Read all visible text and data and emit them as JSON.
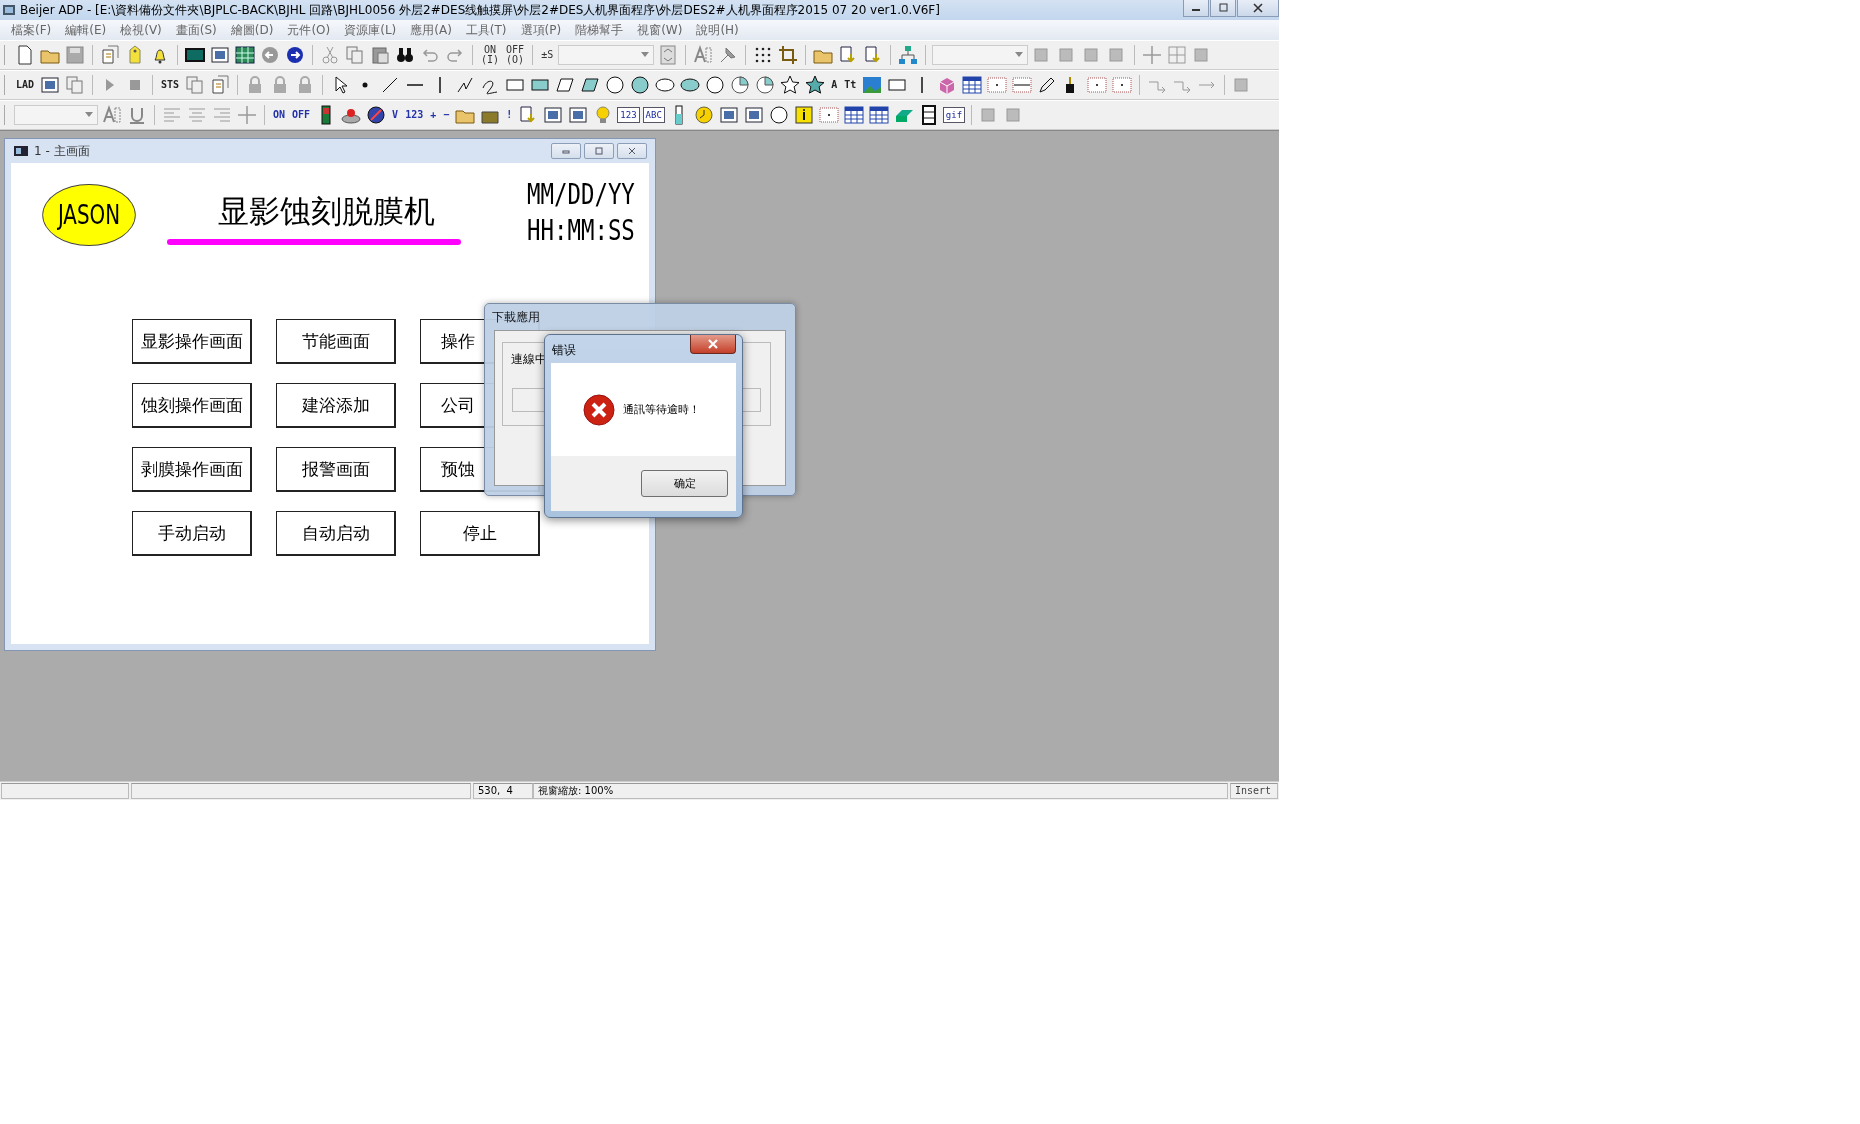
{
  "window": {
    "title": "Beijer ADP - [E:\\資料備份文件夾\\BJPLC-BACK\\BJHL 回路\\BJHL0056 外层2#DES线触摸屏\\外层2#DES人机界面程序\\外层DES2#人机界面程序2015 07 20 ver1.0.V6F]"
  },
  "menu": [
    "檔案(F)",
    "編輯(E)",
    "檢視(V)",
    "畫面(S)",
    "繪圖(D)",
    "元件(O)",
    "資源庫(L)",
    "應用(A)",
    "工具(T)",
    "選項(P)",
    "階梯幫手",
    "視窗(W)",
    "說明(H)"
  ],
  "toolbars": [
    {
      "items": [
        {
          "kind": "icon"
        },
        {
          "kind": "icon"
        },
        {
          "kind": "icon"
        },
        {
          "kind": "sep"
        },
        {
          "kind": "icon"
        },
        {
          "kind": "icon"
        },
        {
          "kind": "icon"
        },
        {
          "kind": "sep"
        },
        {
          "kind": "icon"
        },
        {
          "kind": "icon"
        },
        {
          "kind": "icon"
        },
        {
          "kind": "icon"
        },
        {
          "kind": "icon"
        },
        {
          "kind": "sep"
        },
        {
          "kind": "icon"
        },
        {
          "kind": "icon"
        },
        {
          "kind": "icon"
        },
        {
          "kind": "icon"
        },
        {
          "kind": "icon"
        },
        {
          "kind": "icon"
        },
        {
          "kind": "sep"
        },
        {
          "kind": "text",
          "label": "ON",
          "sub": "(I)"
        },
        {
          "kind": "text",
          "label": "OFF",
          "sub": "(O)"
        },
        {
          "kind": "sep"
        },
        {
          "kind": "text",
          "label": "±S"
        },
        {
          "kind": "combo"
        },
        {
          "kind": "icon"
        },
        {
          "kind": "sep"
        },
        {
          "kind": "icon"
        },
        {
          "kind": "icon"
        },
        {
          "kind": "sep"
        },
        {
          "kind": "icon"
        },
        {
          "kind": "icon"
        },
        {
          "kind": "sep"
        },
        {
          "kind": "icon"
        },
        {
          "kind": "icon"
        },
        {
          "kind": "icon"
        },
        {
          "kind": "sep"
        },
        {
          "kind": "icon"
        },
        {
          "kind": "sep"
        },
        {
          "kind": "combo"
        },
        {
          "kind": "icon"
        },
        {
          "kind": "icon"
        },
        {
          "kind": "icon"
        },
        {
          "kind": "icon"
        },
        {
          "kind": "sep"
        },
        {
          "kind": "icon"
        },
        {
          "kind": "icon"
        },
        {
          "kind": "icon"
        }
      ]
    },
    {
      "items": [
        {
          "kind": "text",
          "label": "LAD"
        },
        {
          "kind": "icon"
        },
        {
          "kind": "icon"
        },
        {
          "kind": "sep"
        },
        {
          "kind": "icon"
        },
        {
          "kind": "icon"
        },
        {
          "kind": "sep"
        },
        {
          "kind": "text",
          "label": "STS"
        },
        {
          "kind": "icon"
        },
        {
          "kind": "icon"
        },
        {
          "kind": "sep"
        },
        {
          "kind": "icon"
        },
        {
          "kind": "icon"
        },
        {
          "kind": "icon"
        },
        {
          "kind": "sep"
        },
        {
          "kind": "icon"
        },
        {
          "kind": "icon"
        },
        {
          "kind": "icon"
        },
        {
          "kind": "icon"
        },
        {
          "kind": "icon"
        },
        {
          "kind": "icon"
        },
        {
          "kind": "icon"
        },
        {
          "kind": "icon"
        },
        {
          "kind": "icon"
        },
        {
          "kind": "icon"
        },
        {
          "kind": "icon"
        },
        {
          "kind": "icon"
        },
        {
          "kind": "icon"
        },
        {
          "kind": "icon"
        },
        {
          "kind": "icon"
        },
        {
          "kind": "icon"
        },
        {
          "kind": "icon"
        },
        {
          "kind": "icon"
        },
        {
          "kind": "icon"
        },
        {
          "kind": "icon"
        },
        {
          "kind": "text",
          "label": "A"
        },
        {
          "kind": "text",
          "label": "Tt"
        },
        {
          "kind": "icon"
        },
        {
          "kind": "icon"
        },
        {
          "kind": "icon"
        },
        {
          "kind": "icon"
        },
        {
          "kind": "icon"
        },
        {
          "kind": "icon"
        },
        {
          "kind": "icon"
        },
        {
          "kind": "icon"
        },
        {
          "kind": "icon"
        },
        {
          "kind": "icon"
        },
        {
          "kind": "icon"
        },
        {
          "kind": "sep"
        },
        {
          "kind": "icon"
        },
        {
          "kind": "icon"
        },
        {
          "kind": "icon"
        },
        {
          "kind": "sep"
        },
        {
          "kind": "icon"
        }
      ]
    },
    {
      "items": [
        {
          "kind": "combo"
        },
        {
          "kind": "icon"
        },
        {
          "kind": "icon"
        },
        {
          "kind": "sep"
        },
        {
          "kind": "icon"
        },
        {
          "kind": "icon"
        },
        {
          "kind": "icon"
        },
        {
          "kind": "icon"
        },
        {
          "kind": "sep"
        },
        {
          "kind": "text",
          "label": "ON"
        },
        {
          "kind": "text",
          "label": "OFF"
        },
        {
          "kind": "icon"
        },
        {
          "kind": "icon"
        },
        {
          "kind": "icon"
        },
        {
          "kind": "text",
          "label": "V"
        },
        {
          "kind": "text",
          "label": "123"
        },
        {
          "kind": "text",
          "label": "+"
        },
        {
          "kind": "text",
          "label": "−"
        },
        {
          "kind": "icon"
        },
        {
          "kind": "icon"
        },
        {
          "kind": "text",
          "label": "!"
        },
        {
          "kind": "icon"
        },
        {
          "kind": "icon"
        },
        {
          "kind": "icon"
        },
        {
          "kind": "icon"
        },
        {
          "kind": "boxtext",
          "label": "123"
        },
        {
          "kind": "boxtext",
          "label": "ABC"
        },
        {
          "kind": "icon"
        },
        {
          "kind": "icon"
        },
        {
          "kind": "icon"
        },
        {
          "kind": "icon"
        },
        {
          "kind": "icon"
        },
        {
          "kind": "icon"
        },
        {
          "kind": "icon"
        },
        {
          "kind": "icon"
        },
        {
          "kind": "icon"
        },
        {
          "kind": "icon"
        },
        {
          "kind": "icon"
        },
        {
          "kind": "boxtext",
          "label": "gif"
        },
        {
          "kind": "sep"
        },
        {
          "kind": "icon"
        },
        {
          "kind": "icon"
        }
      ]
    }
  ],
  "child_window": {
    "title": "1 - 主画面",
    "logo": "JASON",
    "heading": "显影蚀刻脱膜机",
    "date": "MM/DD/YY",
    "time": "HH:MM:SS",
    "buttons": [
      [
        "显影操作画面",
        "节能画面",
        "操作"
      ],
      [
        "蚀刻操作画面",
        "建浴添加",
        "公司"
      ],
      [
        "剥膜操作画面",
        "报警画面",
        "预蚀"
      ],
      [
        "手动启动",
        "自动启动",
        "停止"
      ]
    ]
  },
  "download_dialog": {
    "title": "下載應用",
    "status": "連線中",
    "progress": {
      "level": 0
    }
  },
  "error_dialog": {
    "title": "错误",
    "message": "通訊等待逾時！",
    "ok": "确定"
  },
  "status_bar": [
    "530,  4",
    "視窗縮放: 100%",
    "Insert"
  ]
}
